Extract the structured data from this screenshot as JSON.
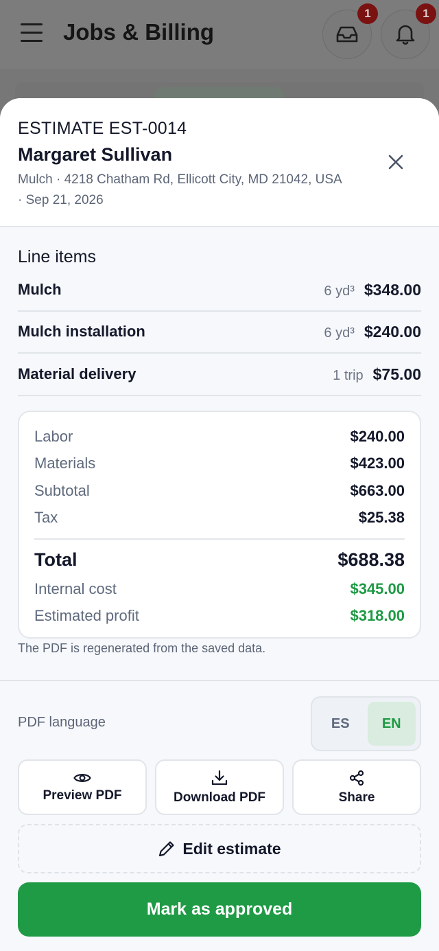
{
  "app_header": {
    "title": "Jobs & Billing",
    "inbox_badge": "1",
    "notifications_badge": "1"
  },
  "estimate": {
    "number": "ESTIMATE EST-0014",
    "customer": "Margaret Sullivan",
    "meta": "Mulch · 4218 Chatham Rd, Ellicott City, MD 21042, USA · Sep 21, 2026"
  },
  "line_items_title": "Line items",
  "line_items": [
    {
      "name": "Mulch",
      "qty": "6 yd³",
      "amount": "$348.00"
    },
    {
      "name": "Mulch installation",
      "qty": "6 yd³",
      "amount": "$240.00"
    },
    {
      "name": "Material delivery",
      "qty": "1 trip",
      "amount": "$75.00"
    }
  ],
  "totals": {
    "labor_label": "Labor",
    "labor": "$240.00",
    "materials_label": "Materials",
    "materials": "$423.00",
    "subtotal_label": "Subtotal",
    "subtotal": "$663.00",
    "tax_label": "Tax",
    "tax": "$25.38",
    "total_label": "Total",
    "total": "$688.38",
    "internal_cost_label": "Internal cost",
    "internal_cost": "$345.00",
    "profit_label": "Estimated profit",
    "profit": "$318.00"
  },
  "pdf_note": "The PDF is regenerated from the saved data.",
  "pdf_language": {
    "label": "PDF language",
    "options": [
      "ES",
      "EN"
    ],
    "selected": "EN"
  },
  "actions": {
    "preview": "Preview PDF",
    "download": "Download PDF",
    "share": "Share",
    "edit": "Edit estimate",
    "approve": "Mark as approved"
  },
  "colors": {
    "accent_green": "#1f9a45",
    "badge_red": "#7a1212"
  },
  "icons": {
    "menu": "hamburger-icon",
    "inbox": "inbox-icon",
    "bell": "bell-icon",
    "close": "close-icon",
    "preview": "eye-icon",
    "download": "download-icon",
    "share": "share-icon",
    "edit": "pencil-icon"
  }
}
